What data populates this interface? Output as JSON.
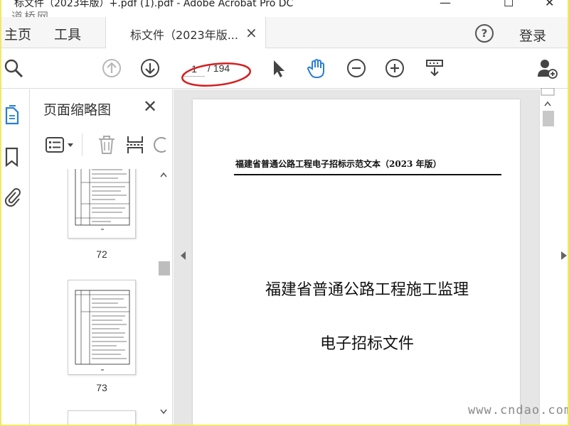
{
  "window": {
    "title": "标文件（2023年版）+.pdf (1).pdf - Adobe Acrobat Pro DC",
    "minimize_label": "—",
    "maximize_label": "☐",
    "close_label": "✕"
  },
  "watermark": {
    "top_left": "道桥网",
    "bottom_right": "www.cndao.com"
  },
  "tabs": {
    "home": "主页",
    "tools": "工具",
    "document": "标文件（2023年版...",
    "document_close": "×"
  },
  "header_right": {
    "help": "?",
    "login": "登录"
  },
  "toolbar": {
    "current_page": "1",
    "total_pages": "/ 194",
    "icons": [
      "search-icon",
      "previous-page-icon",
      "next-page-icon",
      "select-arrow-icon",
      "hand-tool-icon",
      "zoom-out-icon",
      "zoom-in-icon",
      "page-display-icon",
      "share-user-icon"
    ]
  },
  "left_rail": {
    "icons": [
      "page-thumbnails-icon",
      "bookmark-icon",
      "attachment-icon"
    ]
  },
  "thumbnail_panel": {
    "title": "页面缩略图",
    "close_label": "✕",
    "thumbnails": [
      {
        "page": "72"
      },
      {
        "page": "73"
      }
    ]
  },
  "document": {
    "header": "福建省普通公路工程电子招标示范文本（2023 年版）",
    "title": "福建省普通公路工程施工监理",
    "subtitle": "电子招标文件"
  },
  "colors": {
    "accent_blue": "#2a7fd4",
    "frame_yellow": "#f0e96a",
    "annotation_red": "#d42020"
  }
}
